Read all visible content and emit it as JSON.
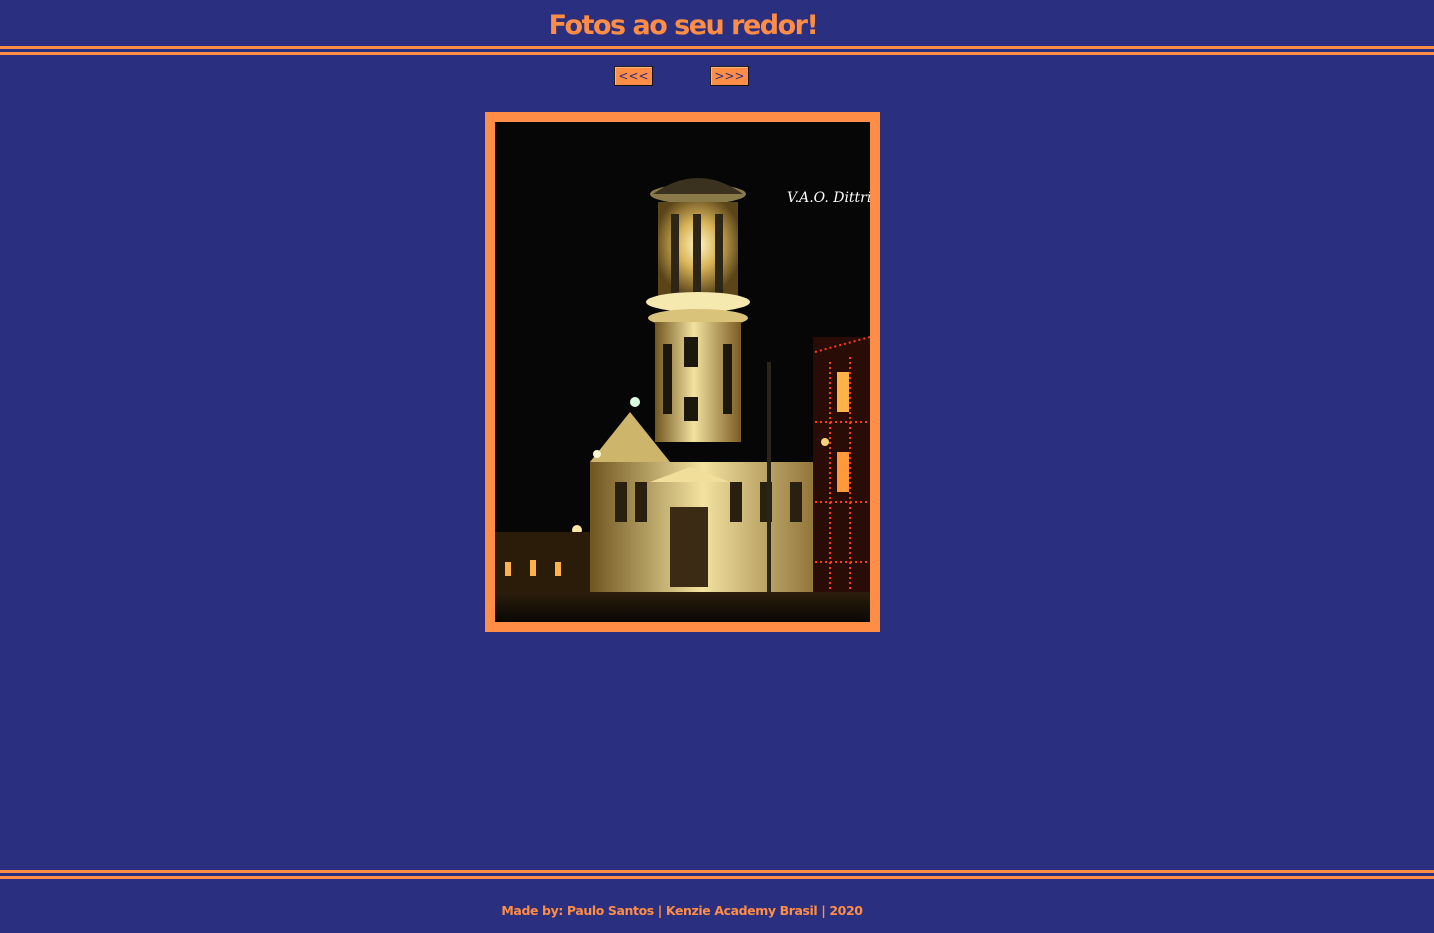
{
  "header": {
    "title": "Fotos ao seu redor!"
  },
  "nav": {
    "prev_label": "<<<",
    "next_label": ">>>"
  },
  "photo": {
    "alt": "Illuminated clock tower building at night",
    "signature": "V.A.O. Dittrich"
  },
  "footer": {
    "credits": "Made by: Paulo Santos | Kenzie Academy Brasil | 2020"
  },
  "theme": {
    "background": "#2a2f80",
    "accent": "#ff8d45"
  }
}
